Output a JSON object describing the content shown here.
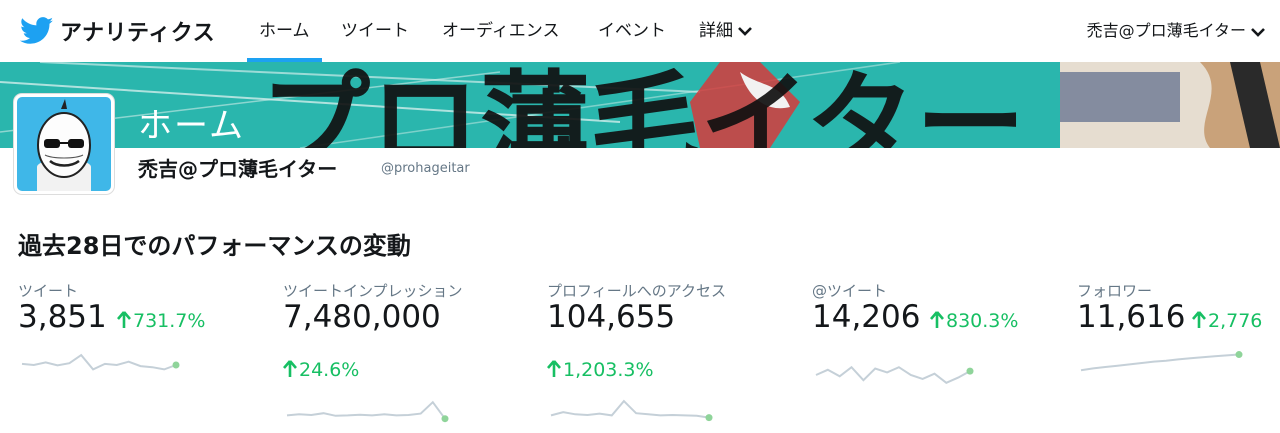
{
  "nav": {
    "brand": "アナリティクス",
    "tabs": [
      {
        "label": "ホーム",
        "active": true
      },
      {
        "label": "ツイート",
        "active": false
      },
      {
        "label": "オーディエンス",
        "active": false
      },
      {
        "label": "イベント",
        "active": false
      },
      {
        "label": "詳細",
        "active": false,
        "dropdown": true
      }
    ],
    "user_menu": "禿吉@プロ薄毛イター"
  },
  "banner": {
    "title": "ホーム"
  },
  "profile": {
    "name": "禿吉@プロ薄毛イター",
    "handle": "@prohageitar"
  },
  "section_title": "過去28日でのパフォーマンスの変動",
  "stats": [
    {
      "label": "ツイート",
      "value": "3,851",
      "change": "731.7%",
      "sparkline": [
        0.55,
        0.5,
        0.62,
        0.48,
        0.58,
        0.95,
        0.3,
        0.55,
        0.5,
        0.65,
        0.45,
        0.4,
        0.3,
        0.5
      ]
    },
    {
      "label": "ツイートインプレッション",
      "value": "7,480,000",
      "change": "24.6%",
      "sparkline": [
        0.3,
        0.35,
        0.32,
        0.4,
        0.28,
        0.3,
        0.33,
        0.3,
        0.35,
        0.3,
        0.32,
        0.38,
        0.9,
        0.15
      ]
    },
    {
      "label": "プロフィールへのアクセス",
      "value": "104,655",
      "change": "1,203.3%",
      "sparkline": [
        0.3,
        0.45,
        0.35,
        0.32,
        0.38,
        0.3,
        0.95,
        0.4,
        0.35,
        0.3,
        0.32,
        0.3,
        0.28,
        0.2
      ]
    },
    {
      "label": "@ツイート",
      "value": "14,206",
      "change": "830.3%",
      "sparkline": [
        0.5,
        0.7,
        0.45,
        0.8,
        0.3,
        0.75,
        0.6,
        0.8,
        0.5,
        0.35,
        0.55,
        0.2,
        0.4,
        0.65
      ]
    },
    {
      "label": "フォロワー",
      "value": "11,616",
      "change": "2,776",
      "sparkline": [
        0.1,
        0.2,
        0.28,
        0.35,
        0.42,
        0.5,
        0.58,
        0.63,
        0.7,
        0.76,
        0.82,
        0.88,
        0.92,
        0.97
      ]
    }
  ],
  "colors": {
    "accent": "#1da1f2",
    "positive": "#17bf63",
    "sparkline": "#c5d0d8",
    "sparkline_end": "#8fd49a"
  }
}
